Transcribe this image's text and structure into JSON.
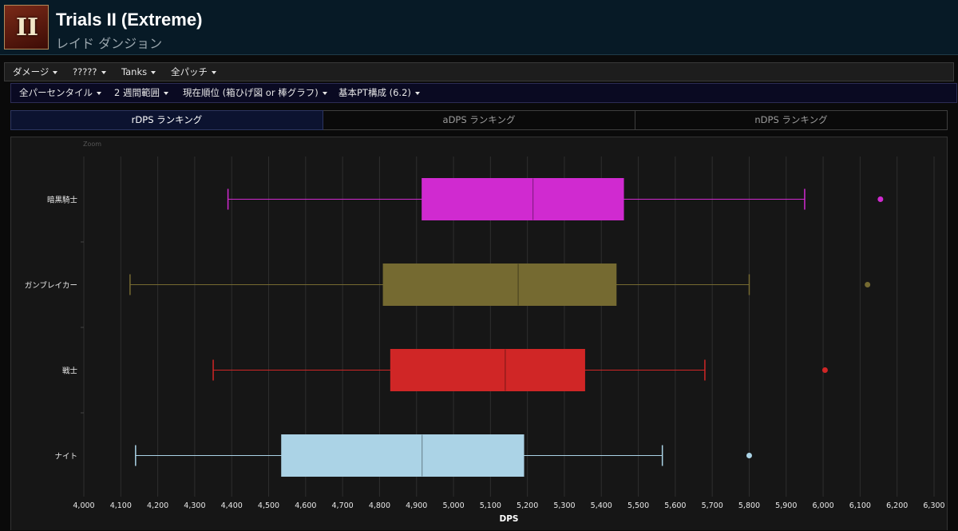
{
  "header": {
    "title": "Trials II (Extreme)",
    "subtitle": "レイド ダンジョン",
    "logo_glyph": "II"
  },
  "menu": {
    "items": [
      {
        "label": "ダメージ"
      },
      {
        "label": "?????"
      },
      {
        "label": "Tanks"
      },
      {
        "label": "全パッチ"
      }
    ]
  },
  "submenu": {
    "items": [
      {
        "label": "全パーセンタイル"
      },
      {
        "label": "2 週間範囲"
      },
      {
        "label": "現在順位 (箱ひげ図 or 棒グラフ)"
      },
      {
        "label": "基本PT構成 (6.2)"
      }
    ]
  },
  "tabs": [
    {
      "label": "rDPS ランキング",
      "active": true
    },
    {
      "label": "aDPS ランキング",
      "active": false
    },
    {
      "label": "nDPS ランキング",
      "active": false
    }
  ],
  "chart": {
    "zoom_label": "Zoom"
  },
  "chart_data": {
    "type": "boxplot",
    "orientation": "horizontal",
    "xlabel": "DPS",
    "xlim": [
      4000,
      6300
    ],
    "x_ticks": [
      "4,000",
      "4,100",
      "4,200",
      "4,300",
      "4,400",
      "4,500",
      "4,600",
      "4,700",
      "4,800",
      "4,900",
      "5,000",
      "5,100",
      "5,200",
      "5,300",
      "5,400",
      "5,500",
      "5,600",
      "5,700",
      "5,800",
      "5,900",
      "6,000",
      "6,100",
      "6,200",
      "6,300"
    ],
    "grid": true,
    "categories": [
      "暗黒騎士",
      "ガンブレイカー",
      "戦士",
      "ナイト"
    ],
    "series": [
      {
        "category": "暗黒騎士",
        "color": "#d02ad0",
        "min": 4390,
        "q1": 4915,
        "median": 5215,
        "q3": 5460,
        "max": 5950,
        "outlier": 6155
      },
      {
        "category": "ガンブレイカー",
        "color": "#756a31",
        "min": 4125,
        "q1": 4810,
        "median": 5175,
        "q3": 5440,
        "max": 5800,
        "outlier": 6120
      },
      {
        "category": "戦士",
        "color": "#d02626",
        "min": 4350,
        "q1": 4830,
        "median": 5140,
        "q3": 5355,
        "max": 5680,
        "outlier": 6005
      },
      {
        "category": "ナイト",
        "color": "#abd3e6",
        "min": 4140,
        "q1": 4535,
        "median": 4915,
        "q3": 5190,
        "max": 5565,
        "outlier": 5800
      }
    ]
  }
}
